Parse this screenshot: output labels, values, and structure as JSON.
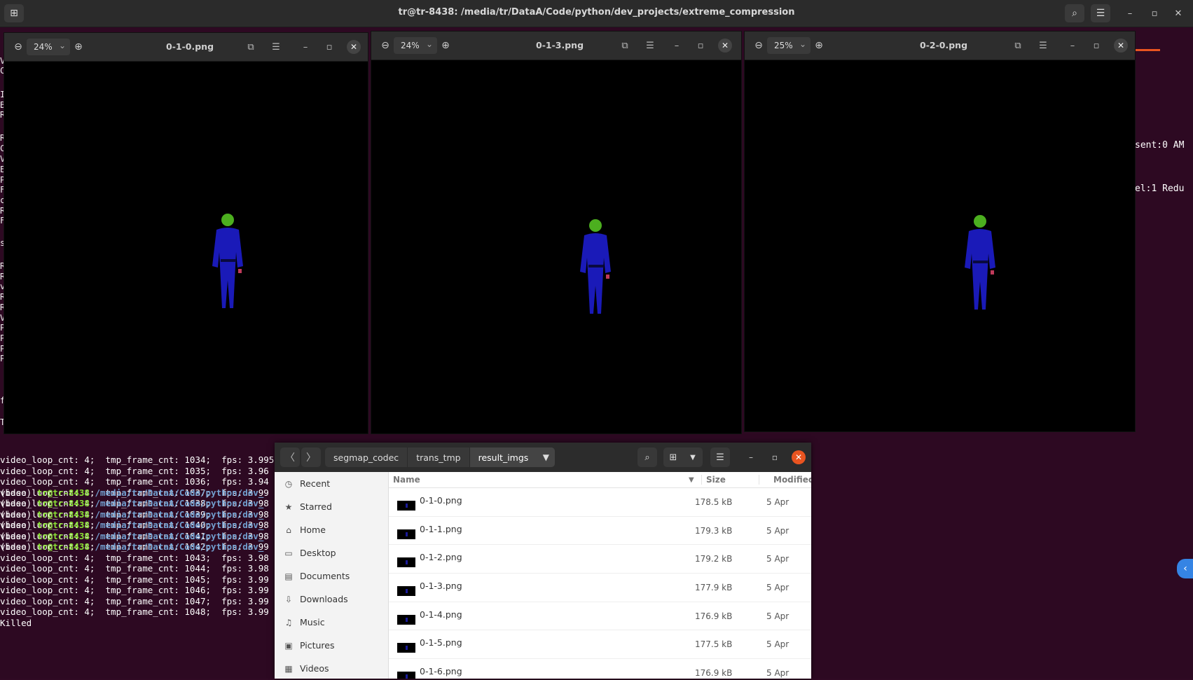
{
  "terminal": {
    "title": "tr@tr-8438: /media/tr/DataA/Code/python/dev_projects/extreme_compression",
    "side_texts": [
      "sent:0 AM",
      "el:1 Redu"
    ],
    "left_fragments": [
      "V",
      "C",
      "I",
      "B",
      "R",
      "R",
      "C",
      "V",
      "E",
      "P",
      "F",
      "c",
      "R",
      "F",
      "s",
      "R",
      "R",
      "v",
      "R",
      "R",
      "V",
      "P",
      "P",
      "P",
      "P",
      "f",
      "T"
    ],
    "lines": [
      "video_loop_cnt: 4;  tmp_frame_cnt: 1034;  fps: 3.995",
      "video_loop_cnt: 4;  tmp_frame_cnt: 1035;  fps: 3.96",
      "video_loop_cnt: 4;  tmp_frame_cnt: 1036;  fps: 3.94",
      "video_loop_cnt: 4;  tmp_frame_cnt: 1037;  fps: 3.99",
      "video_loop_cnt: 4;  tmp_frame_cnt: 1038;  fps: 3.98",
      "video_loop_cnt: 4;  tmp_frame_cnt: 1039;  fps: 3.98",
      "video_loop_cnt: 4;  tmp_frame_cnt: 1040;  fps: 3.98",
      "video_loop_cnt: 4;  tmp_frame_cnt: 1041;  fps: 3.98",
      "video_loop_cnt: 4;  tmp_frame_cnt: 1042;  fps: 3.99",
      "video_loop_cnt: 4;  tmp_frame_cnt: 1043;  fps: 3.98",
      "video_loop_cnt: 4;  tmp_frame_cnt: 1044;  fps: 3.98",
      "video_loop_cnt: 4;  tmp_frame_cnt: 1045;  fps: 3.99",
      "video_loop_cnt: 4;  tmp_frame_cnt: 1046;  fps: 3.99",
      "video_loop_cnt: 4;  tmp_frame_cnt: 1047;  fps: 3.99",
      "video_loop_cnt: 4;  tmp_frame_cnt: 1048;  fps: 3.99",
      "Killed"
    ],
    "prompt": {
      "env": "(base) ",
      "user": "tr@tr-8438",
      "sep": ":",
      "path": "/media/tr/DataA/Code/python/dev_"
    },
    "prompt_count": 6
  },
  "viewers": [
    {
      "zoom": "24%",
      "title": "0-1-0.png"
    },
    {
      "zoom": "24%",
      "title": "0-1-3.png"
    },
    {
      "zoom": "25%",
      "title": "0-2-0.png"
    }
  ],
  "files": {
    "breadcrumbs": [
      "segmap_codec",
      "trans_tmp",
      "result_imgs"
    ],
    "sidebar": [
      {
        "label": "Recent",
        "icon": "clock-icon"
      },
      {
        "label": "Starred",
        "icon": "star-icon"
      },
      {
        "label": "Home",
        "icon": "home-icon"
      },
      {
        "label": "Desktop",
        "icon": "desktop-icon"
      },
      {
        "label": "Documents",
        "icon": "documents-icon"
      },
      {
        "label": "Downloads",
        "icon": "downloads-icon"
      },
      {
        "label": "Music",
        "icon": "music-icon"
      },
      {
        "label": "Pictures",
        "icon": "pictures-icon"
      },
      {
        "label": "Videos",
        "icon": "videos-icon"
      }
    ],
    "columns": {
      "name": "Name",
      "size": "Size",
      "modified": "Modified"
    },
    "rows": [
      {
        "name": "0-1-0.png",
        "size": "178.5 kB",
        "modified": "5 Apr"
      },
      {
        "name": "0-1-1.png",
        "size": "179.3 kB",
        "modified": "5 Apr"
      },
      {
        "name": "0-1-2.png",
        "size": "179.2 kB",
        "modified": "5 Apr"
      },
      {
        "name": "0-1-3.png",
        "size": "177.9 kB",
        "modified": "5 Apr"
      },
      {
        "name": "0-1-4.png",
        "size": "176.9 kB",
        "modified": "5 Apr"
      },
      {
        "name": "0-1-5.png",
        "size": "177.5 kB",
        "modified": "5 Apr"
      },
      {
        "name": "0-1-6.png",
        "size": "176.9 kB",
        "modified": "5 Apr"
      }
    ]
  },
  "colors": {
    "terminal_bg": "#2d0922",
    "accent": "#e95420",
    "prompt_user": "#8ae234",
    "prompt_path": "#729fcf"
  }
}
